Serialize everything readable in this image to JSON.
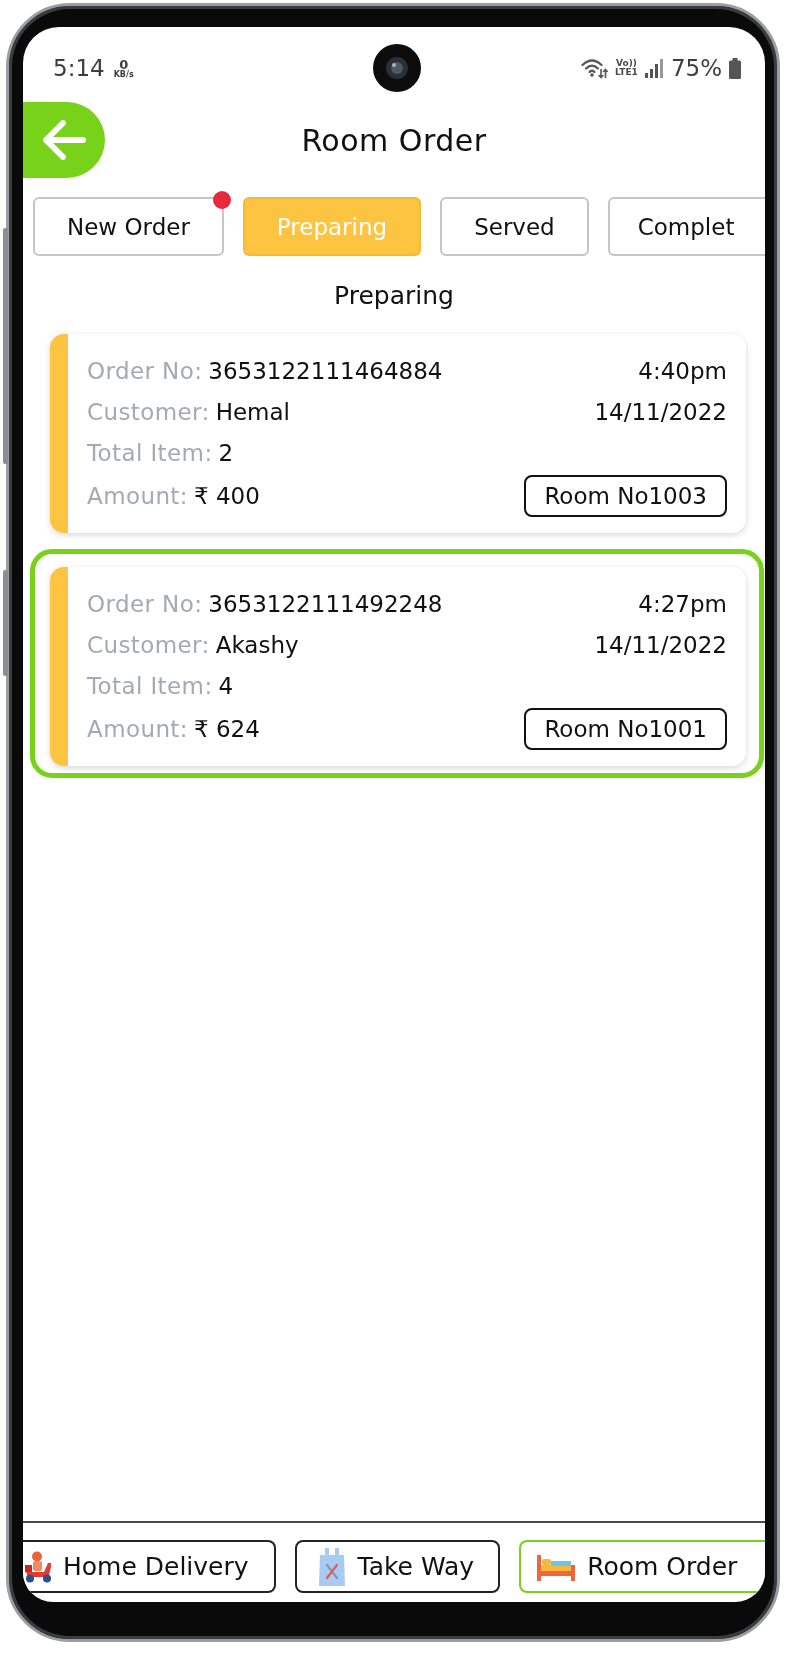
{
  "status_bar": {
    "time": "5:14",
    "speed_value": "0",
    "speed_unit": "KB/s",
    "network_type_top": "Vo))",
    "network_type_bottom": "LTE1",
    "battery": "75%"
  },
  "header": {
    "title": "Room Order"
  },
  "tabs": [
    {
      "label": "New Order",
      "selected": false,
      "notification": true
    },
    {
      "label": "Preparing",
      "selected": true,
      "notification": false
    },
    {
      "label": "Served",
      "selected": false,
      "notification": false
    },
    {
      "label": "Complet",
      "selected": false,
      "notification": false
    }
  ],
  "section_title": "Preparing",
  "orders": [
    {
      "order_label": "Order No:",
      "order_no": "3653122111464884",
      "time": "4:40pm",
      "customer_label": "Customer:",
      "customer": "Hemal",
      "date": "14/11/2022",
      "items_label": "Total Item:",
      "items": "2",
      "amount_label": "Amount:",
      "amount": "₹ 400",
      "room": "Room No1003",
      "selected": false
    },
    {
      "order_label": "Order No:",
      "order_no": "3653122111492248",
      "time": "4:27pm",
      "customer_label": "Customer:",
      "customer": "Akashy",
      "date": "14/11/2022",
      "items_label": "Total Item:",
      "items": "4",
      "amount_label": "Amount:",
      "amount": "₹ 624",
      "room": "Room No1001",
      "selected": true
    }
  ],
  "bottom_nav": [
    {
      "label": "Home Delivery",
      "selected": false
    },
    {
      "label": "Take Way",
      "selected": false
    },
    {
      "label": "Room Order",
      "selected": true
    }
  ]
}
